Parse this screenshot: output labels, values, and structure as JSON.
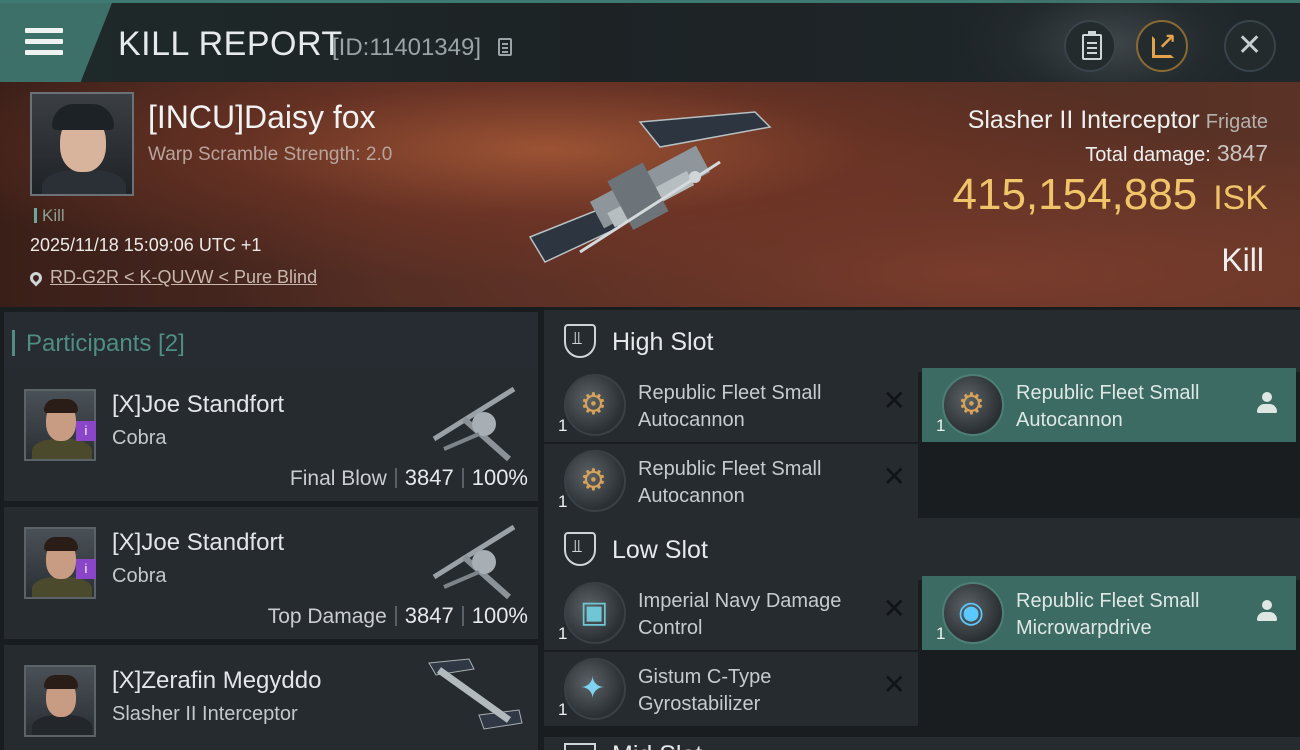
{
  "header": {
    "title": "KILL REPORT",
    "id_text": "[ID:11401349]",
    "icons": [
      "menu-icon",
      "copy-icon",
      "clipboard-icon",
      "share-icon",
      "close-icon"
    ]
  },
  "victim": {
    "name": "[INCU]Daisy fox",
    "warp_scramble": "Warp Scramble Strength: 2.0",
    "kill_tag": "Kill",
    "datetime": "2025/11/18 15:09:06 UTC +1",
    "location": "RD-G2R < K-QUVW < Pure Blind",
    "ship_name": "Slasher II Interceptor",
    "ship_class": "Frigate",
    "total_damage_label": "Total damage:",
    "total_damage": "3847",
    "isk_value": "415,154,885",
    "isk_unit": "ISK",
    "result_label": "Kill"
  },
  "participants": {
    "title": "Participants [2]",
    "items": [
      {
        "name": "[X]Joe Standfort",
        "ship": "Cobra",
        "role": "Final Blow",
        "damage": "3847",
        "percent": "100%"
      },
      {
        "name": "[X]Joe Standfort",
        "ship": "Cobra",
        "role": "Top Damage",
        "damage": "3847",
        "percent": "100%"
      },
      {
        "name": "[X]Zerafin Megyddo",
        "ship": "Slasher II Interceptor",
        "role": "",
        "damage": "",
        "percent": ""
      }
    ]
  },
  "fitting": {
    "high_slot": {
      "label": "High Slot",
      "modules": [
        {
          "name": "Republic Fleet Small Autocannon",
          "qty": "1",
          "status": "destroyed"
        },
        {
          "name": "Republic Fleet Small Autocannon",
          "qty": "1",
          "status": "dropped"
        },
        {
          "name": "Republic Fleet Small Autocannon",
          "qty": "1",
          "status": "destroyed"
        }
      ]
    },
    "low_slot": {
      "label": "Low Slot",
      "modules": [
        {
          "name": "Imperial Navy Damage Control",
          "qty": "1",
          "status": "destroyed"
        },
        {
          "name": "Republic Fleet Small Microwarpdrive",
          "qty": "1",
          "status": "dropped"
        },
        {
          "name": "Gistum C-Type Gyrostabilizer",
          "qty": "1",
          "status": "destroyed"
        }
      ]
    },
    "mid_slot": {
      "label": "Mid Slot"
    }
  },
  "colors": {
    "accent_teal": "#3d7068",
    "isk_gold": "#f0c468",
    "owned_module_bg": "#3b6b63",
    "corp_badge": "#8a45c8"
  }
}
